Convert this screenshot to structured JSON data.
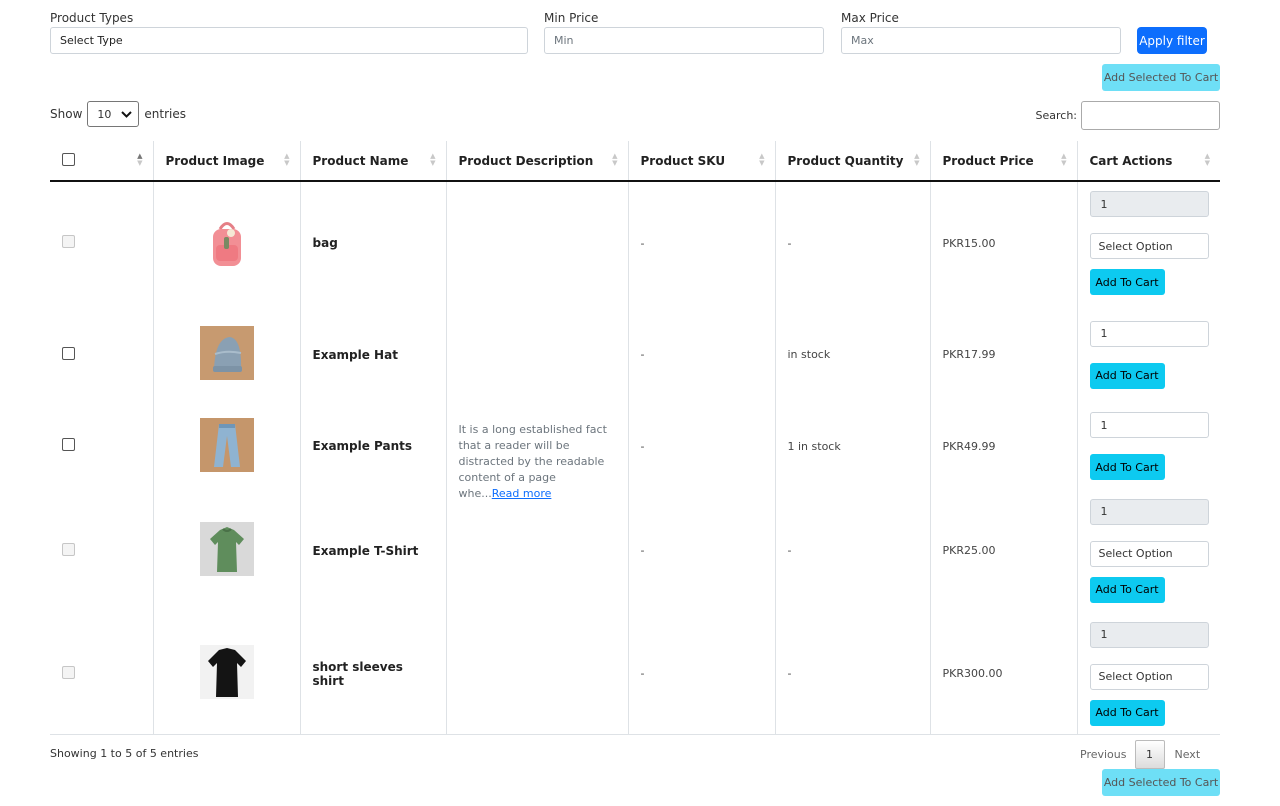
{
  "filters": {
    "product_types_label": "Product Types",
    "product_types_value": "Select Type",
    "min_price_label": "Min Price",
    "min_price_placeholder": "Min",
    "max_price_label": "Max Price",
    "max_price_placeholder": "Max",
    "apply_label": "Apply filter"
  },
  "add_selected_label": "Add Selected To Cart",
  "length": {
    "show": "Show",
    "value": "10",
    "entries": "entries"
  },
  "search": {
    "label": "Search:",
    "value": ""
  },
  "columns": [
    "Product Image",
    "Product Name",
    "Product Description",
    "Product SKU",
    "Product Quantity",
    "Product Price",
    "Cart Actions"
  ],
  "description": {
    "text": "It is a long established fact that a reader will be distracted by the readable content of a page whe...",
    "read_more": "Read more"
  },
  "rows": [
    {
      "name": "bag",
      "sku": "-",
      "quantity": "-",
      "price": "PKR15.00",
      "qty_value": "1",
      "option": "Select Option",
      "add_label": "Add To Cart"
    },
    {
      "name": "Example Hat",
      "sku": "-",
      "quantity": "in stock",
      "price": "PKR17.99",
      "qty_value": "1",
      "add_label": "Add To Cart"
    },
    {
      "name": "Example Pants",
      "sku": "-",
      "quantity": "1 in stock",
      "price": "PKR49.99",
      "qty_value": "1",
      "add_label": "Add To Cart"
    },
    {
      "name": "Example T-Shirt",
      "sku": "-",
      "quantity": "-",
      "price": "PKR25.00",
      "qty_value": "1",
      "option": "Select Option",
      "add_label": "Add To Cart"
    },
    {
      "name": "short sleeves shirt",
      "sku": "-",
      "quantity": "-",
      "price": "PKR300.00",
      "qty_value": "1",
      "option": "Select Option",
      "add_label": "Add To Cart"
    }
  ],
  "info": "Showing 1 to 5 of 5 entries",
  "pagination": {
    "previous": "Previous",
    "page": "1",
    "next": "Next"
  },
  "colors": {
    "primary": "#0d6efd",
    "cyan": "#0dcaf0",
    "cyan_disabled": "#6edff6"
  }
}
